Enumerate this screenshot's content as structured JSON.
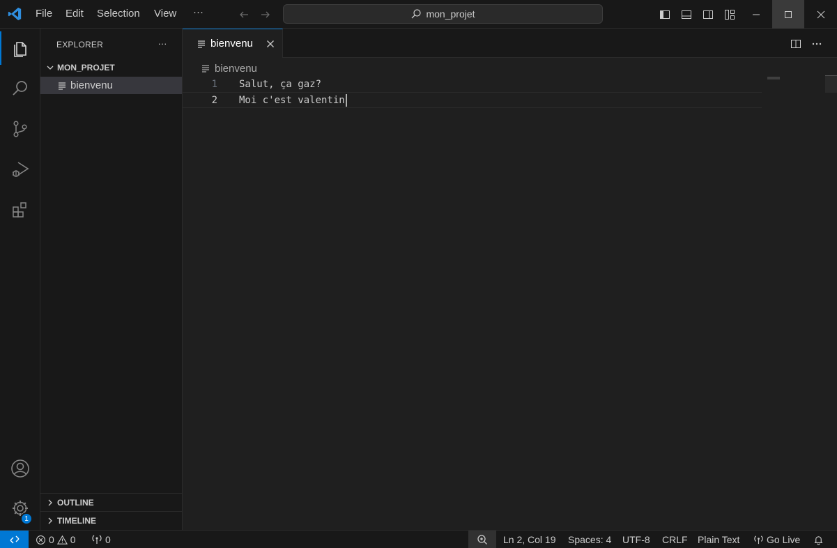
{
  "titlebar": {
    "menu": [
      "File",
      "Edit",
      "Selection",
      "View"
    ],
    "more": "···",
    "search_text": "mon_projet"
  },
  "sidebar": {
    "title": "EXPLORER",
    "more": "···",
    "folder": "MON_PROJET",
    "files": [
      "bienvenu"
    ],
    "panes": [
      "OUTLINE",
      "TIMELINE"
    ]
  },
  "activity": {
    "settings_badge": "1"
  },
  "editor": {
    "tab_label": "bienvenu",
    "breadcrumb": "bienvenu",
    "lines": [
      {
        "number": "1",
        "text": "Salut, ça gaz?"
      },
      {
        "number": "2",
        "text": "Moi c'est valentin"
      }
    ]
  },
  "statusbar": {
    "errors": "0",
    "warnings": "0",
    "ports": "0",
    "position": "Ln 2, Col 19",
    "spaces": "Spaces: 4",
    "encoding": "UTF-8",
    "eol": "CRLF",
    "language": "Plain Text",
    "go_live": "Go Live"
  },
  "colors": {
    "accent": "#0078d4",
    "background": "#1f1f1f",
    "chrome": "#181818"
  }
}
